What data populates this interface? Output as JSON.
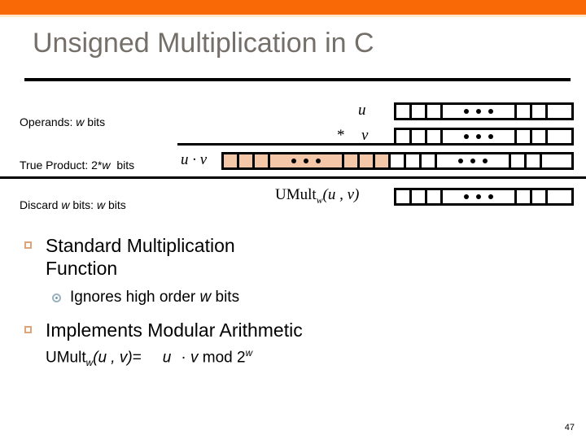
{
  "slide": {
    "title": "Unsigned Multiplication in C",
    "page_number": "47",
    "accent_color": "#F96A07",
    "title_color": "#756F6A",
    "fill_color": "#F4C7A8",
    "bullet_marker_color": "#E0A479",
    "subbullet_marker_color": "#9BB2C0"
  },
  "diagram": {
    "labels": {
      "operands": "Operands: w bits",
      "true_product": "True Product: 2*w  bits",
      "discard": "Discard w bits: w bits"
    },
    "rows": [
      {
        "name": "operand-u",
        "symbol": "u",
        "operator": "",
        "cells": 7,
        "filled": 0
      },
      {
        "name": "operand-v",
        "symbol": "v",
        "operator": "*",
        "cells": 7,
        "filled": 0
      },
      {
        "name": "true-product",
        "symbol": "u · v",
        "operator": "",
        "cells": 14,
        "filled": 7
      },
      {
        "name": "umult-result",
        "symbol": "UMultw(u , v)",
        "operator": "",
        "cells": 7,
        "filled": 0
      }
    ],
    "umult_result_label": {
      "prefix": "UMult",
      "sub": "w",
      "args": "(u , v)"
    },
    "ellipsis_glyph": "• • •"
  },
  "content": {
    "bullets": [
      {
        "marker": "square",
        "text_line1": "Standard Multiplication",
        "text_line2": "Function",
        "sub": [
          {
            "marker": "circle",
            "pre": "Ignores high order ",
            "em": "w",
            "post": " bits"
          }
        ]
      },
      {
        "marker": "square",
        "text_line1": "Implements Modular Arithmetic",
        "formula": {
          "prefix": "UMult",
          "sub": "w",
          "args": "(u , v)",
          "equals": "=",
          "u": "u",
          "dot": "·",
          "v": "v",
          "mod": "mod 2",
          "sup": "w"
        }
      }
    ]
  }
}
